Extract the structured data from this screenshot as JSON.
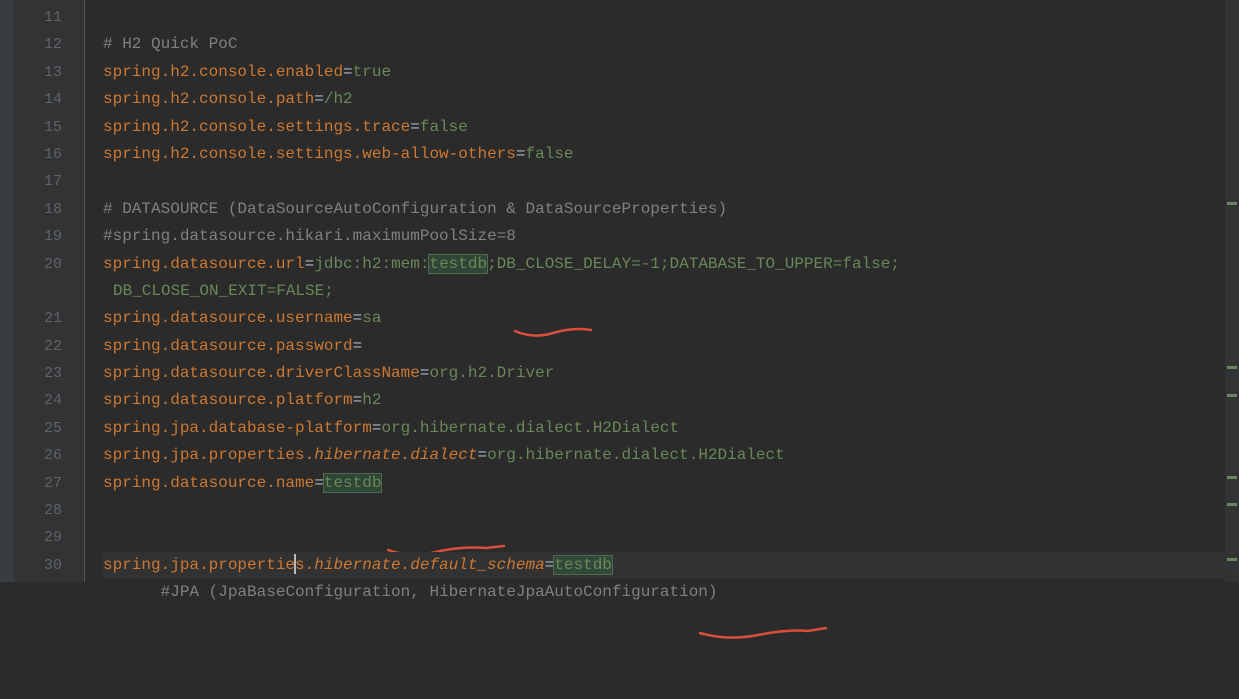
{
  "lineNumbers": [
    "11",
    "12",
    "13",
    "14",
    "15",
    "16",
    "17",
    "18",
    "19",
    "20",
    "",
    "21",
    "22",
    "23",
    "24",
    "25",
    "26",
    "27",
    "28",
    "29",
    "30"
  ],
  "code": {
    "l12": "# H2 Quick PoC",
    "l13_key": "spring.h2.console.enabled",
    "l13_val": "true",
    "l14_key": "spring.h2.console.path",
    "l14_val": "/h2",
    "l15_key": "spring.h2.console.settings.trace",
    "l15_val": "false",
    "l16_key": "spring.h2.console.settings.web-allow-others",
    "l16_val": "false",
    "l18": "# DATASOURCE (DataSourceAutoConfiguration & DataSourceProperties)",
    "l19": "#spring.datasource.hikari.maximumPoolSize=8",
    "l20_key": "spring.datasource.url",
    "l20_v1": "jdbc:h2:mem:",
    "l20_hl": "testdb",
    "l20_v2": ";DB_CLOSE_DELAY=-1;DATABASE_TO_UPPER=false;",
    "l20w": "DB_CLOSE_ON_EXIT=FALSE;",
    "l21_key": "spring.datasource.username",
    "l21_val": "sa",
    "l22_key": "spring.datasource.password",
    "l23_key": "spring.datasource.driverClassName",
    "l23_val": "org.h2.Driver",
    "l24_key": "spring.datasource.platform",
    "l24_val": "h2",
    "l25_key": "spring.jpa.database-platform",
    "l25_val": "org.hibernate.dialect.H2Dialect",
    "l26_k1": "spring.jpa.properties.",
    "l26_k2": "hibernate.dialect",
    "l26_val": "org.hibernate.dialect.H2Dialect",
    "l27_key": "spring.datasource.name",
    "l27_hl": "testdb",
    "l29_c1": "#",
    "l29_c2": "JPA (JpaBaseConfiguration, HibernateJpaAutoConfiguration)",
    "l30_k1a": "spring.jpa.propertie",
    "l30_k1b": "s.",
    "l30_k2": "hibernate.default_schema",
    "l30_hl": "testdb"
  }
}
